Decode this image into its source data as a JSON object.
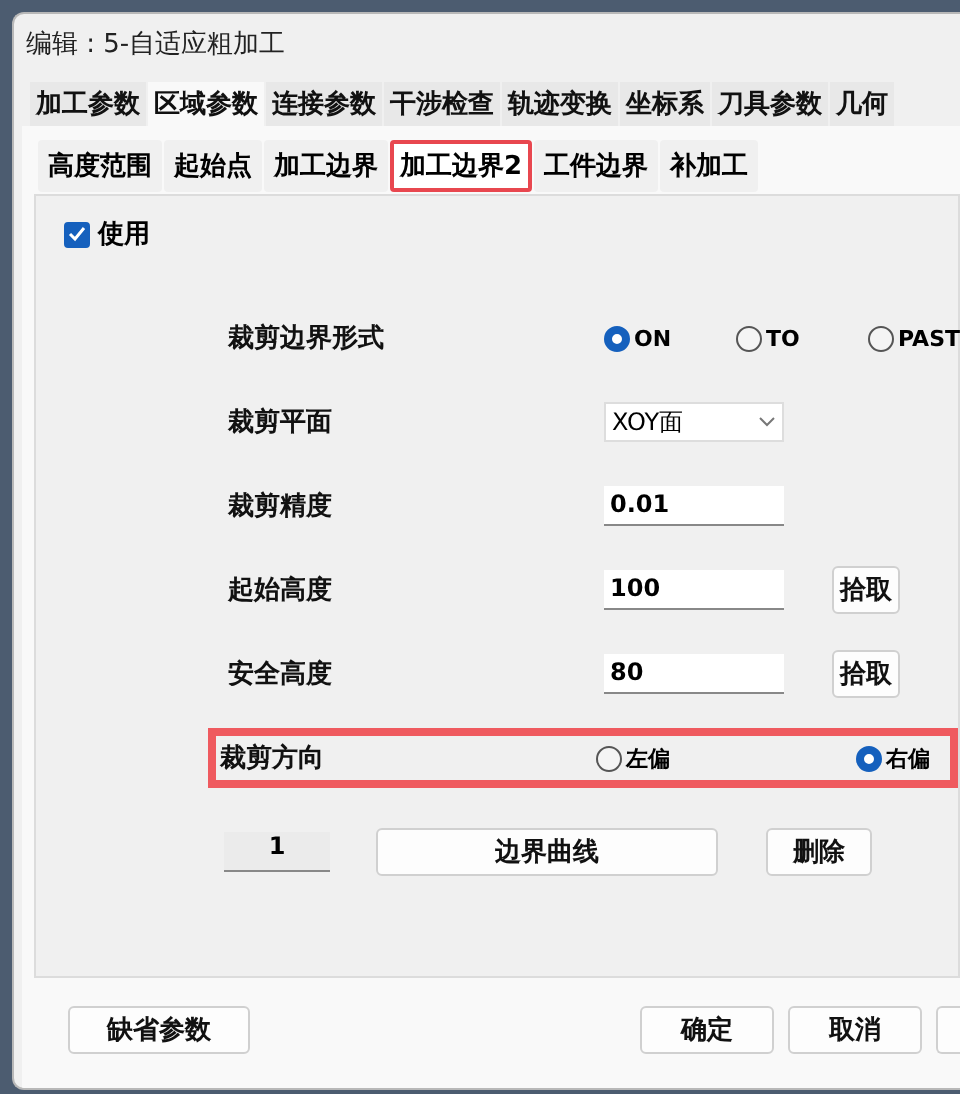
{
  "window": {
    "title": "编辑 : 5-自适应粗加工"
  },
  "tabs": [
    {
      "label": "加工参数",
      "selected": false
    },
    {
      "label": "区域参数",
      "selected": true
    },
    {
      "label": "连接参数",
      "selected": false
    },
    {
      "label": "干涉检查",
      "selected": false
    },
    {
      "label": "轨迹变换",
      "selected": false
    },
    {
      "label": "坐标系",
      "selected": false
    },
    {
      "label": "刀具参数",
      "selected": false
    },
    {
      "label": "几何",
      "selected": false
    }
  ],
  "subtabs": [
    {
      "label": "高度范围",
      "selected": false,
      "highlighted": false
    },
    {
      "label": "起始点",
      "selected": false,
      "highlighted": false
    },
    {
      "label": "加工边界",
      "selected": false,
      "highlighted": false
    },
    {
      "label": "加工边界2",
      "selected": true,
      "highlighted": true
    },
    {
      "label": "工件边界",
      "selected": false,
      "highlighted": false
    },
    {
      "label": "补加工",
      "selected": false,
      "highlighted": false
    }
  ],
  "use_checkbox": {
    "label": "使用",
    "checked": true
  },
  "rows": [
    {
      "kind": "radio",
      "label": "裁剪边界形式",
      "highlighted": false,
      "options": [
        {
          "label": "ON",
          "selected": true
        },
        {
          "label": "TO",
          "selected": false
        },
        {
          "label": "PAST",
          "selected": false
        }
      ]
    },
    {
      "kind": "select",
      "label": "裁剪平面",
      "value": "XOY面"
    },
    {
      "kind": "input",
      "label": "裁剪精度",
      "value": "0.01"
    },
    {
      "kind": "input",
      "label": "起始高度",
      "value": "100",
      "button": "拾取"
    },
    {
      "kind": "input",
      "label": "安全高度",
      "value": "80",
      "button": "拾取"
    },
    {
      "kind": "radio",
      "label": "裁剪方向",
      "highlighted": true,
      "options": [
        {
          "label": "左偏",
          "selected": false
        },
        {
          "label": "右偏",
          "selected": true
        }
      ]
    }
  ],
  "boundary": {
    "index": "1",
    "curve_button": "边界曲线",
    "delete_button": "删除"
  },
  "footer": {
    "default_button": "缺省参数",
    "buttons": [
      "确定",
      "取消"
    ]
  }
}
